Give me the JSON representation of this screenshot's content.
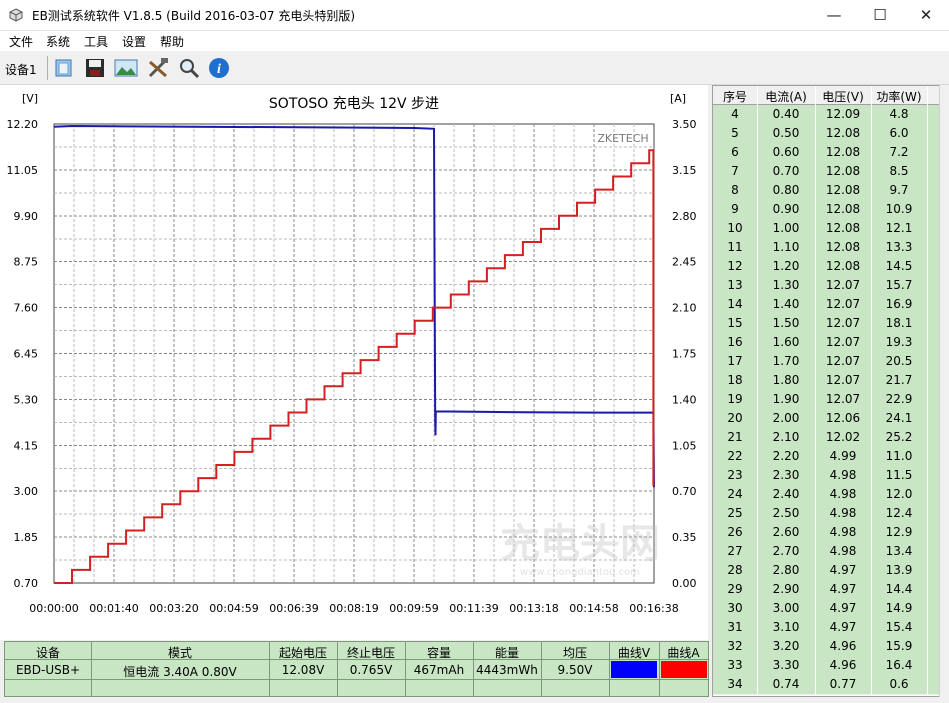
{
  "window": {
    "title": "EB测试系统软件 V1.8.5 (Build 2016-03-07 充电头特别版)",
    "minimize": "—",
    "maximize": "☐",
    "close": "✕"
  },
  "menu": [
    "文件",
    "系统",
    "工具",
    "设置",
    "帮助"
  ],
  "toolbar": {
    "device_label": "设备1",
    "icons": [
      "open-folder-icon",
      "save-disk-icon",
      "chart-image-icon",
      "tools-icon",
      "zoom-icon",
      "info-icon"
    ]
  },
  "chart_data": {
    "type": "line",
    "title": "SOTOSO 充电头 12V 步进",
    "watermark": "ZKETECH",
    "y_left_unit": "[V]",
    "y_right_unit": "[A]",
    "y_left_ticks": [
      "12.20",
      "11.05",
      "9.90",
      "8.75",
      "7.60",
      "6.45",
      "5.30",
      "4.15",
      "3.00",
      "1.85",
      "0.70"
    ],
    "y_right_ticks": [
      "3.50",
      "3.15",
      "2.80",
      "2.45",
      "2.10",
      "1.75",
      "1.40",
      "1.05",
      "0.70",
      "0.35",
      "0.00"
    ],
    "x_ticks": [
      "00:00:00",
      "00:01:40",
      "00:03:20",
      "00:04:59",
      "00:06:39",
      "00:08:19",
      "00:09:59",
      "00:11:39",
      "00:13:18",
      "00:14:58",
      "00:16:38"
    ],
    "ylim_left": [
      0.7,
      12.2
    ],
    "ylim_right": [
      0.0,
      3.5
    ],
    "xlim_seconds": [
      0,
      998
    ],
    "series": [
      {
        "axis": "left",
        "color": "#1a1aa8",
        "points": [
          [
            0,
            12.13
          ],
          [
            30,
            12.15
          ],
          [
            600,
            12.1
          ],
          [
            632,
            12.08
          ],
          [
            634,
            4.8
          ],
          [
            634.5,
            4.4
          ],
          [
            635,
            5.0
          ],
          [
            700,
            4.99
          ],
          [
            780,
            4.98
          ],
          [
            900,
            4.97
          ],
          [
            997,
            4.97
          ],
          [
            998,
            3.1
          ]
        ]
      },
      {
        "axis": "right",
        "color": "#d42020",
        "steps": [
          0.0,
          0.1,
          0.2,
          0.3,
          0.4,
          0.5,
          0.6,
          0.7,
          0.8,
          0.9,
          1.0,
          1.1,
          1.2,
          1.3,
          1.4,
          1.5,
          1.6,
          1.7,
          1.8,
          1.9,
          2.0,
          2.1,
          2.2,
          2.3,
          2.4,
          2.5,
          2.6,
          2.7,
          2.8,
          2.9,
          3.0,
          3.1,
          3.2,
          3.3
        ],
        "step_seconds": 30,
        "end_drop": 0.74
      }
    ]
  },
  "side_table": {
    "headers": [
      "序号",
      "电流(A)",
      "电压(V)",
      "功率(W)"
    ],
    "rows": [
      [
        "4",
        "0.40",
        "12.09",
        "4.8"
      ],
      [
        "5",
        "0.50",
        "12.08",
        "6.0"
      ],
      [
        "6",
        "0.60",
        "12.08",
        "7.2"
      ],
      [
        "7",
        "0.70",
        "12.08",
        "8.5"
      ],
      [
        "8",
        "0.80",
        "12.08",
        "9.7"
      ],
      [
        "9",
        "0.90",
        "12.08",
        "10.9"
      ],
      [
        "10",
        "1.00",
        "12.08",
        "12.1"
      ],
      [
        "11",
        "1.10",
        "12.08",
        "13.3"
      ],
      [
        "12",
        "1.20",
        "12.08",
        "14.5"
      ],
      [
        "13",
        "1.30",
        "12.07",
        "15.7"
      ],
      [
        "14",
        "1.40",
        "12.07",
        "16.9"
      ],
      [
        "15",
        "1.50",
        "12.07",
        "18.1"
      ],
      [
        "16",
        "1.60",
        "12.07",
        "19.3"
      ],
      [
        "17",
        "1.70",
        "12.07",
        "20.5"
      ],
      [
        "18",
        "1.80",
        "12.07",
        "21.7"
      ],
      [
        "19",
        "1.90",
        "12.07",
        "22.9"
      ],
      [
        "20",
        "2.00",
        "12.06",
        "24.1"
      ],
      [
        "21",
        "2.10",
        "12.02",
        "25.2"
      ],
      [
        "22",
        "2.20",
        "4.99",
        "11.0"
      ],
      [
        "23",
        "2.30",
        "4.98",
        "11.5"
      ],
      [
        "24",
        "2.40",
        "4.98",
        "12.0"
      ],
      [
        "25",
        "2.50",
        "4.98",
        "12.4"
      ],
      [
        "26",
        "2.60",
        "4.98",
        "12.9"
      ],
      [
        "27",
        "2.70",
        "4.98",
        "13.4"
      ],
      [
        "28",
        "2.80",
        "4.97",
        "13.9"
      ],
      [
        "29",
        "2.90",
        "4.97",
        "14.4"
      ],
      [
        "30",
        "3.00",
        "4.97",
        "14.9"
      ],
      [
        "31",
        "3.10",
        "4.97",
        "15.4"
      ],
      [
        "32",
        "3.20",
        "4.96",
        "15.9"
      ],
      [
        "33",
        "3.30",
        "4.96",
        "16.4"
      ],
      [
        "34",
        "0.74",
        "0.77",
        "0.6"
      ]
    ]
  },
  "bottom_table": {
    "headers": [
      "设备",
      "模式",
      "起始电压",
      "终止电压",
      "容量",
      "能量",
      "均压",
      "曲线V",
      "曲线A"
    ],
    "row": [
      "EBD-USB+",
      "恒电流  3.40A  0.80V",
      "12.08V",
      "0.765V",
      "467mAh",
      "4443mWh",
      "9.50V",
      "",
      ""
    ],
    "curve_v_color": "#0000ff",
    "curve_a_color": "#ff0000"
  },
  "watermark": {
    "logo_text": "充电头网",
    "url": "www.chongdiantou.com"
  },
  "colors": {
    "table_row_bg": "#c8e6c4",
    "voltage_line": "#1a1aa8",
    "current_line": "#d42020"
  }
}
